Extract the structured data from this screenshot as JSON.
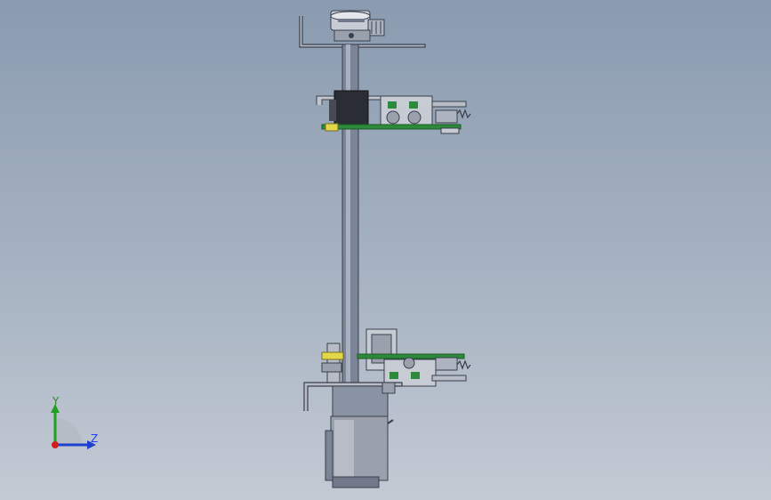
{
  "viewport": {
    "background_top": "#8a9bb0",
    "background_bottom": "#c3cad4"
  },
  "model": {
    "description_icon": "cad-assembly-icon",
    "colors": {
      "metal_dark": "#3f4654",
      "metal_mid": "#8a93a3",
      "metal_light": "#c9cdd6",
      "green_board": "#2d8a3a",
      "yellow_ring": "#e2d64a",
      "black_block": "#2a2d33"
    }
  },
  "triad": {
    "y_label": "Y",
    "z_label": "Z",
    "colors": {
      "y": "#1fa01f",
      "z": "#1f3fd0",
      "x": "#d01f1f"
    }
  }
}
